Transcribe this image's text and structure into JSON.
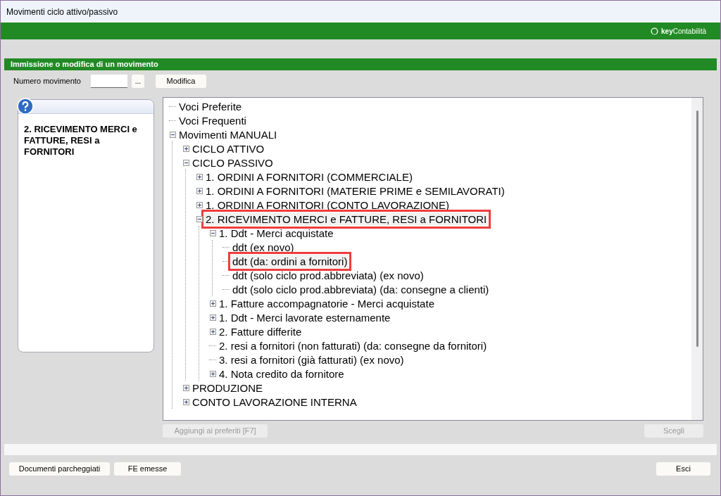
{
  "window": {
    "title": "Movimenti ciclo attivo/passivo"
  },
  "brand": {
    "text": "**key**Contabilità"
  },
  "section": {
    "title": "Immissione o modifica di un movimento"
  },
  "numero": {
    "label": "Numero movimento",
    "lookup_button": "...",
    "modify_button": "Modifica"
  },
  "help_panel": {
    "text": "2. RICEVIMENTO MERCI e FATTURE,  RESI a FORNITORI"
  },
  "tree": [
    {
      "label": "Voci Preferite",
      "kind": "entry",
      "highlighted": false
    },
    {
      "label": "Voci Frequenti",
      "kind": "entry",
      "highlighted": false
    },
    {
      "label": "Movimenti MANUALI",
      "kind": "group",
      "expanded": true,
      "highlighted": false,
      "children": [
        {
          "label": "CICLO ATTIVO",
          "kind": "group",
          "expanded": false,
          "highlighted": false
        },
        {
          "label": "CICLO PASSIVO",
          "kind": "group",
          "expanded": true,
          "highlighted": false,
          "children": [
            {
              "label": "1. ORDINI A FORNITORI (COMMERCIALE)",
              "kind": "group",
              "expanded": false,
              "highlighted": false
            },
            {
              "label": "1. ORDINI A FORNITORI (MATERIE PRIME e SEMILAVORATI)",
              "kind": "group",
              "expanded": false,
              "highlighted": false
            },
            {
              "label": "1. ORDINI A FORNITORI (CONTO LAVORAZIONE)",
              "kind": "group",
              "expanded": false,
              "highlighted": false
            },
            {
              "label": "2. RICEVIMENTO MERCI e FATTURE,  RESI a FORNITORI",
              "kind": "group",
              "expanded": true,
              "highlighted": true,
              "children": [
                {
                  "label": "1. Ddt - Merci acquistate",
                  "kind": "group",
                  "expanded": true,
                  "highlighted": false,
                  "children": [
                    {
                      "label": "ddt (ex novo)",
                      "kind": "entry",
                      "highlighted": false
                    },
                    {
                      "label": "ddt (da: ordini a fornitori)",
                      "kind": "entry",
                      "highlighted": true
                    },
                    {
                      "label": "ddt (solo ciclo prod.abbreviata) (ex novo)",
                      "kind": "entry",
                      "highlighted": false
                    },
                    {
                      "label": "ddt (solo ciclo prod.abbreviata) (da: consegne a clienti)",
                      "kind": "entry",
                      "highlighted": false
                    }
                  ]
                },
                {
                  "label": "1. Fatture accompagnatorie - Merci acquistate",
                  "kind": "group",
                  "expanded": false,
                  "highlighted": false
                },
                {
                  "label": "1. Ddt - Merci lavorate esternamente",
                  "kind": "group",
                  "expanded": false,
                  "highlighted": false
                },
                {
                  "label": "2. Fatture differite",
                  "kind": "group",
                  "expanded": false,
                  "highlighted": false
                },
                {
                  "label": "2. resi a fornitori (non fatturati) (da: consegne da fornitori)",
                  "kind": "entry",
                  "highlighted": false
                },
                {
                  "label": "3. resi a fornitori (già fatturati) (ex novo)",
                  "kind": "entry",
                  "highlighted": false
                },
                {
                  "label": "4. Nota credito da fornitore",
                  "kind": "group",
                  "expanded": false,
                  "highlighted": false
                }
              ]
            }
          ]
        },
        {
          "label": "PRODUZIONE",
          "kind": "group",
          "expanded": false,
          "highlighted": false
        },
        {
          "label": "CONTO LAVORAZIONE INTERNA",
          "kind": "group",
          "expanded": false,
          "highlighted": false
        }
      ]
    }
  ],
  "tree_buttons": [
    {
      "label": "Aggiungi ai preferiti [F7]",
      "disabled": true
    },
    {
      "label": "Scegli",
      "disabled": true
    }
  ],
  "footer_buttons": [
    {
      "label": "Documenti parcheggiati",
      "disabled": false
    },
    {
      "label": "FE emesse",
      "disabled": false
    },
    {
      "label": "Esci",
      "disabled": false
    }
  ]
}
